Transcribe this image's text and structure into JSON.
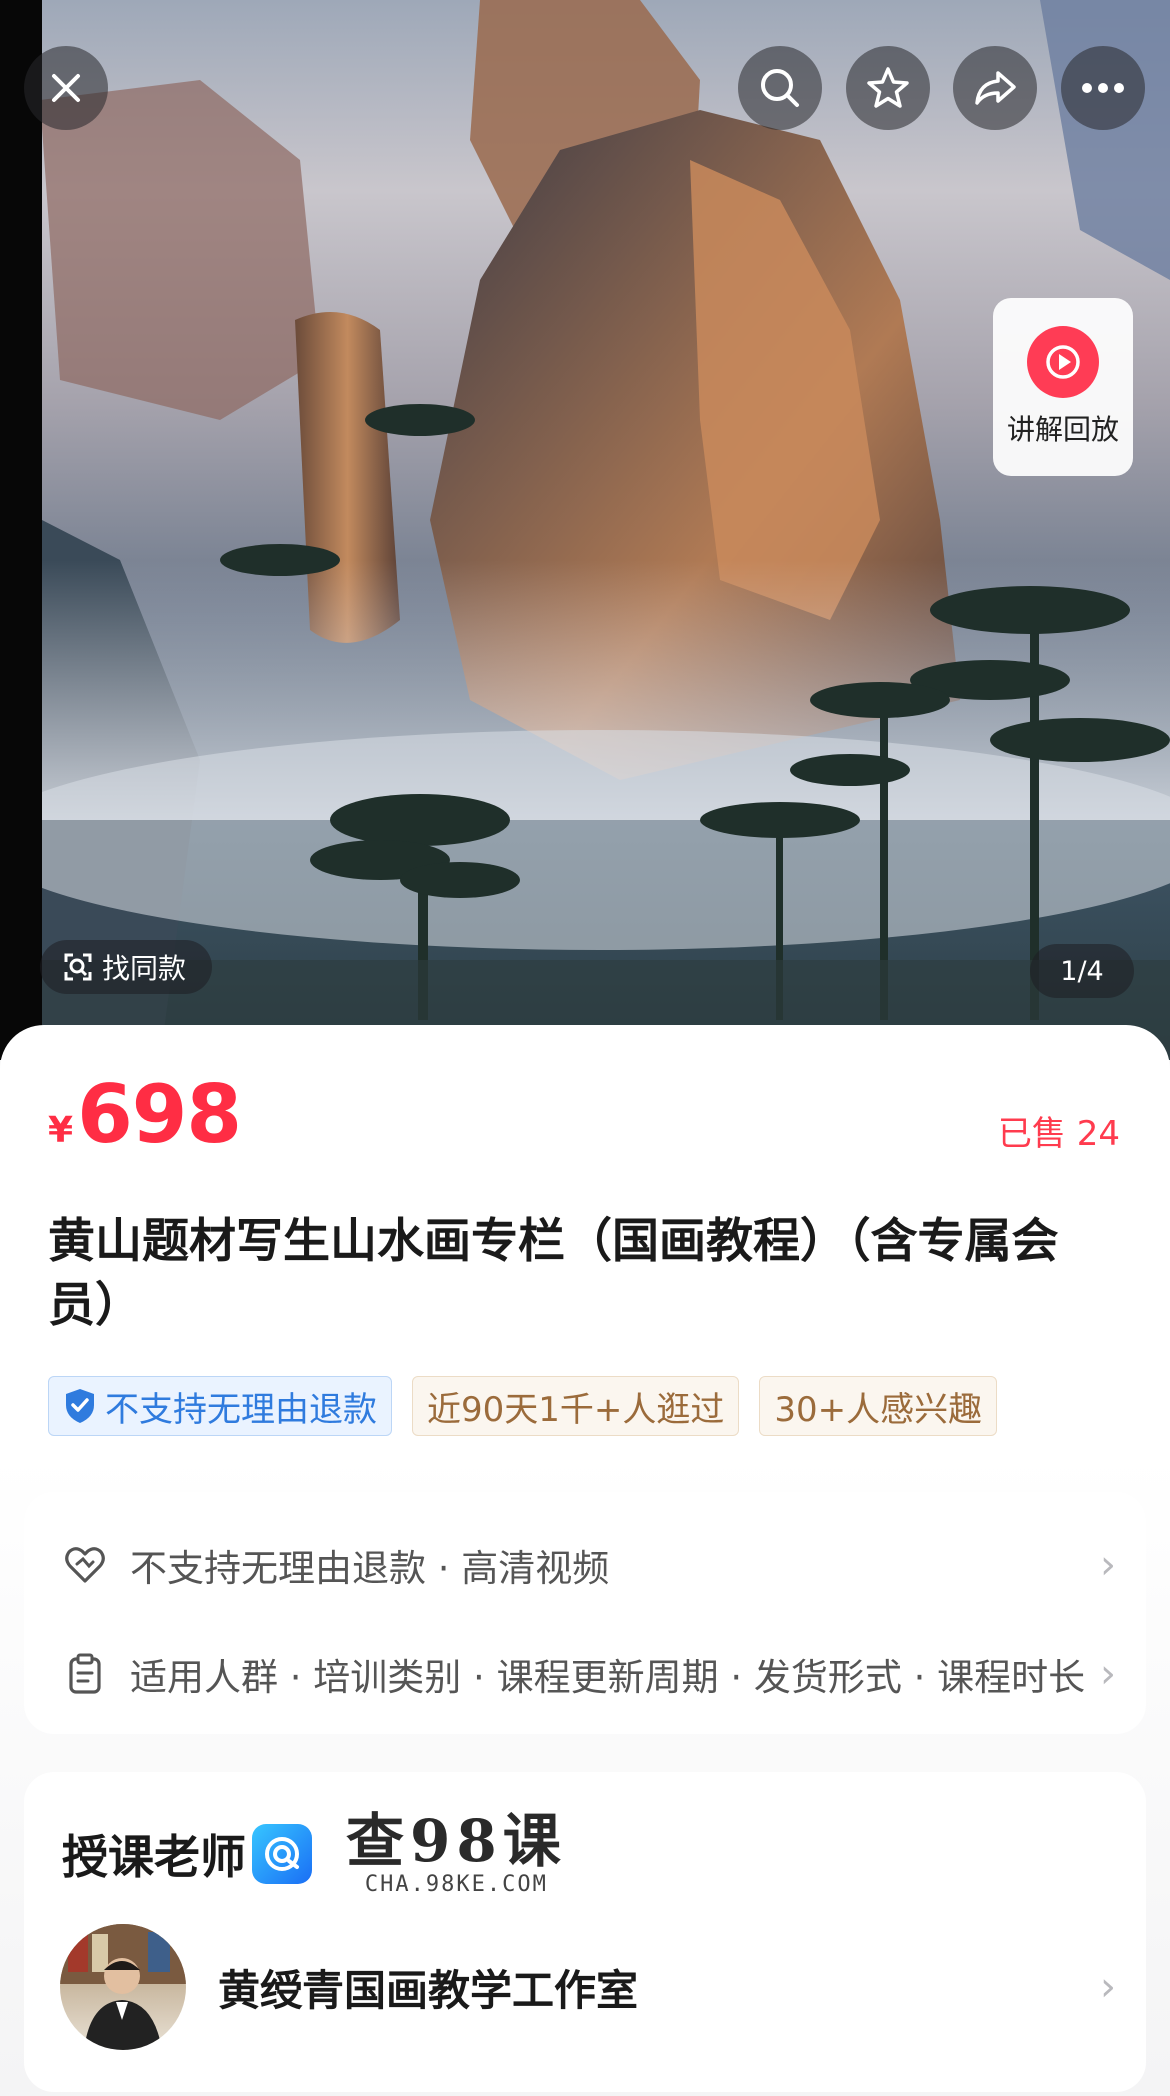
{
  "hero": {
    "find_same_label": "找同款",
    "pager": "1/4",
    "replay_label": "讲解回放"
  },
  "product": {
    "currency": "¥",
    "price": "698",
    "sold": "已售 24",
    "title": "黄山题材写生山水画专栏（国画教程）（含专属会员）",
    "tags": [
      "不支持无理由退款",
      "近90天1千+人逛过",
      "30+人感兴趣"
    ]
  },
  "services": {
    "row1": "不支持无理由退款 · 高清视频",
    "row2": "适用人群 · 培训类别 · 课程更新周期 · 发货形式 · 课程时长"
  },
  "teacher": {
    "heading": "授课老师",
    "watermark_big": "查98课",
    "watermark_small": "CHA.98KE.COM",
    "name": "黄绶青国画教学工作室"
  },
  "icons": [
    "close-icon",
    "search-icon",
    "star-icon",
    "share-icon",
    "more-icon",
    "play-icon",
    "scan-icon",
    "shield-icon",
    "heart-icon",
    "clipboard-icon",
    "chevron-right-icon"
  ],
  "colors": {
    "price": "#ff2d44",
    "tag_blue": "#2f7bde",
    "tag_brown": "#9b6b3b",
    "replay": "#ff3c55"
  }
}
